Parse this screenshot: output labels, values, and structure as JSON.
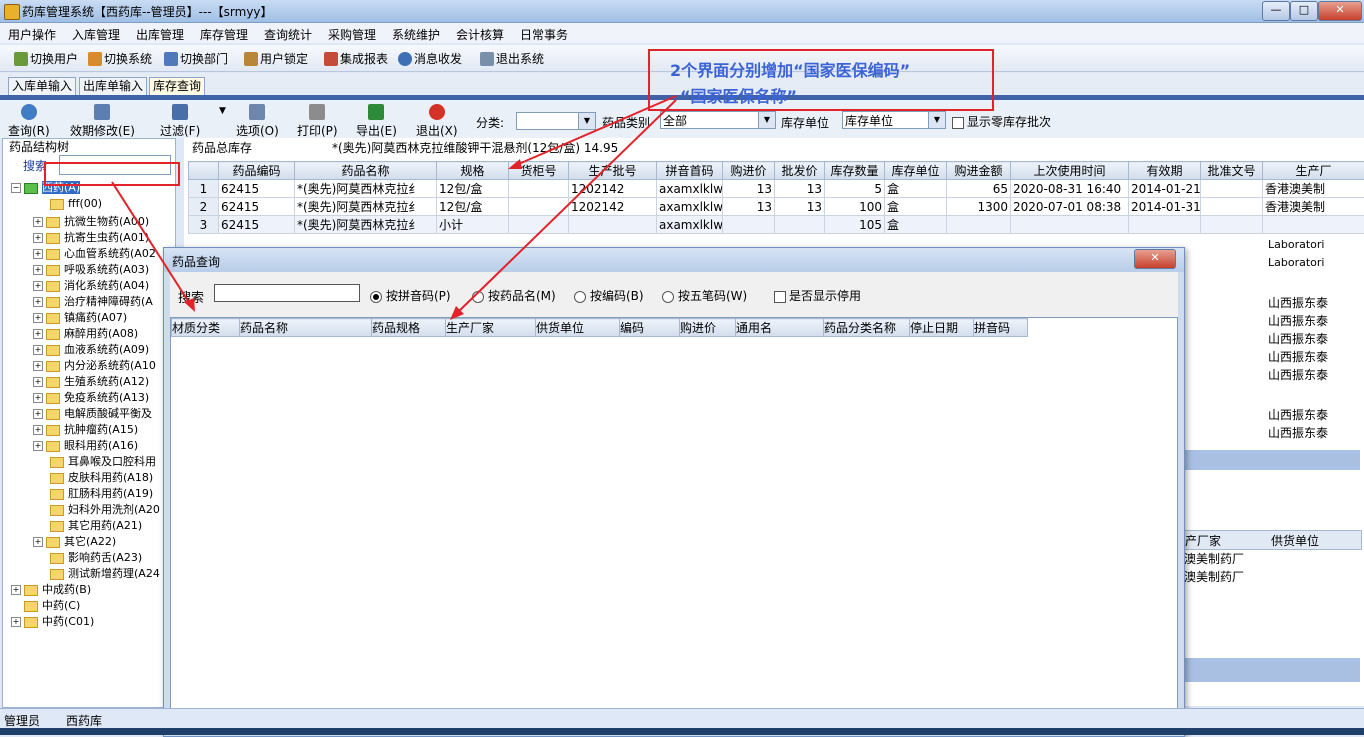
{
  "window": {
    "title": "药库管理系统【西药库--管理员】---【srmyy】",
    "min": "—",
    "max": "□",
    "close": "✕"
  },
  "menu": [
    "用户操作",
    "入库管理",
    "出库管理",
    "库存管理",
    "查询统计",
    "采购管理",
    "系统维护",
    "会计核算",
    "日常事务"
  ],
  "toolbar": [
    "切换用户",
    "切换系统",
    "切换部门",
    "用户锁定",
    "集成报表",
    "消息收发",
    "退出系统"
  ],
  "tabs": [
    "入库单输入",
    "出库单输入",
    "库存查询"
  ],
  "query_toolbar": {
    "buttons": [
      "查询(R)",
      "效期修改(E)",
      "过滤(F)",
      "选项(O)",
      "打印(P)",
      "导出(E)",
      "退出(X)"
    ],
    "category_label": "分类:",
    "category_value": "",
    "drug_type_label": "药品类别",
    "drug_type_value": "全部",
    "stock_unit_label": "库存单位",
    "stock_unit_value": "库存单位",
    "show_zero_label": "显示零库存批次"
  },
  "tree": {
    "title": "药品结构树",
    "search_label": "搜索",
    "root": "西药(A)",
    "items": [
      "fff(00)",
      "抗微生物药(A00)",
      "抗寄生虫药(A01)",
      "心血管系统药(A02",
      "呼吸系统药(A03)",
      "消化系统药(A04)",
      "治疗精神障碍药(A",
      "镇痛药(A07)",
      "麻醉用药(A08)",
      "血液系统药(A09)",
      "内分泌系统药(A10",
      "生殖系统药(A12)",
      "免疫系统药(A13)",
      "电解质酸碱平衡及",
      "抗肿瘤药(A15)",
      "眼科用药(A16)",
      "耳鼻喉及口腔科用",
      "皮肤科用药(A18)",
      "肛肠科用药(A19)",
      "妇科外用洗剂(A20",
      "其它用药(A21)",
      "其它(A22)",
      "影响药舌(A23)",
      "测试新增药理(A24"
    ],
    "others": [
      "中成药(B)",
      "中药(C)",
      "中药(C01)"
    ]
  },
  "main": {
    "summary_label": "药品总库存",
    "summary_value": "*(奥先)阿莫西林克拉维酸钾干混悬剂(12包/盒) 14.95",
    "columns": [
      "",
      "药品编码",
      "药品名称",
      "规格",
      "货柜号",
      "生产批号",
      "拼音首码",
      "购进价",
      "批发价",
      "库存数量",
      "库存单位",
      "购进金额",
      "上次使用时间",
      "有效期",
      "批准文号",
      "生产厂"
    ],
    "rows": [
      [
        "1",
        "62415",
        "*(奥先)阿莫西林克拉纟",
        "12包/盒",
        "",
        "1202142",
        "axamxlklw",
        "13",
        "13",
        "5",
        "盒",
        "65",
        "2020-08-31 16:40",
        "2014-01-21",
        "",
        "香港澳美制"
      ],
      [
        "2",
        "62415",
        "*(奥先)阿莫西林克拉纟",
        "12包/盒",
        "",
        "1202142",
        "axamxlklw",
        "13",
        "13",
        "100",
        "盒",
        "1300",
        "2020-07-01 08:38",
        "2014-01-31",
        "",
        "香港澳美制"
      ],
      [
        "3",
        "62415",
        "*(奥先)阿莫西林克拉纟",
        "小计",
        "",
        "",
        "axamxlklw",
        "",
        "",
        "105",
        "盒",
        "",
        "",
        "",
        "",
        ""
      ]
    ],
    "right_fragments": [
      "Laboratori",
      "Laboratori",
      "山西振东泰",
      "山西振东泰",
      "山西振东泰",
      "山西振东泰",
      "山西振东泰",
      "山西振东泰",
      "山西振东泰"
    ],
    "bottom_columns": [
      "产厂家",
      "供货单位"
    ],
    "bottom_rows": [
      "澳美制药厂",
      "澳美制药厂"
    ]
  },
  "dialog": {
    "title": "药品查询",
    "close": "✕",
    "search_label": "搜索",
    "search_value": "",
    "radios": [
      "按拼音码(P)",
      "按药品名(M)",
      "按编码(B)",
      "按五笔码(W)"
    ],
    "checkbox": "是否显示停用",
    "columns": [
      "材质分类",
      "药品名称",
      "药品规格",
      "生产厂家",
      "供货单位",
      "编码",
      "购进价",
      "通用名",
      "药品分类名称",
      "停止日期",
      "拼音码"
    ]
  },
  "annotation": {
    "line1": "2个界面分别增加“国家医保编码”",
    "line2": "“国家医保名称”"
  },
  "status": [
    "管理员",
    "西药库"
  ]
}
